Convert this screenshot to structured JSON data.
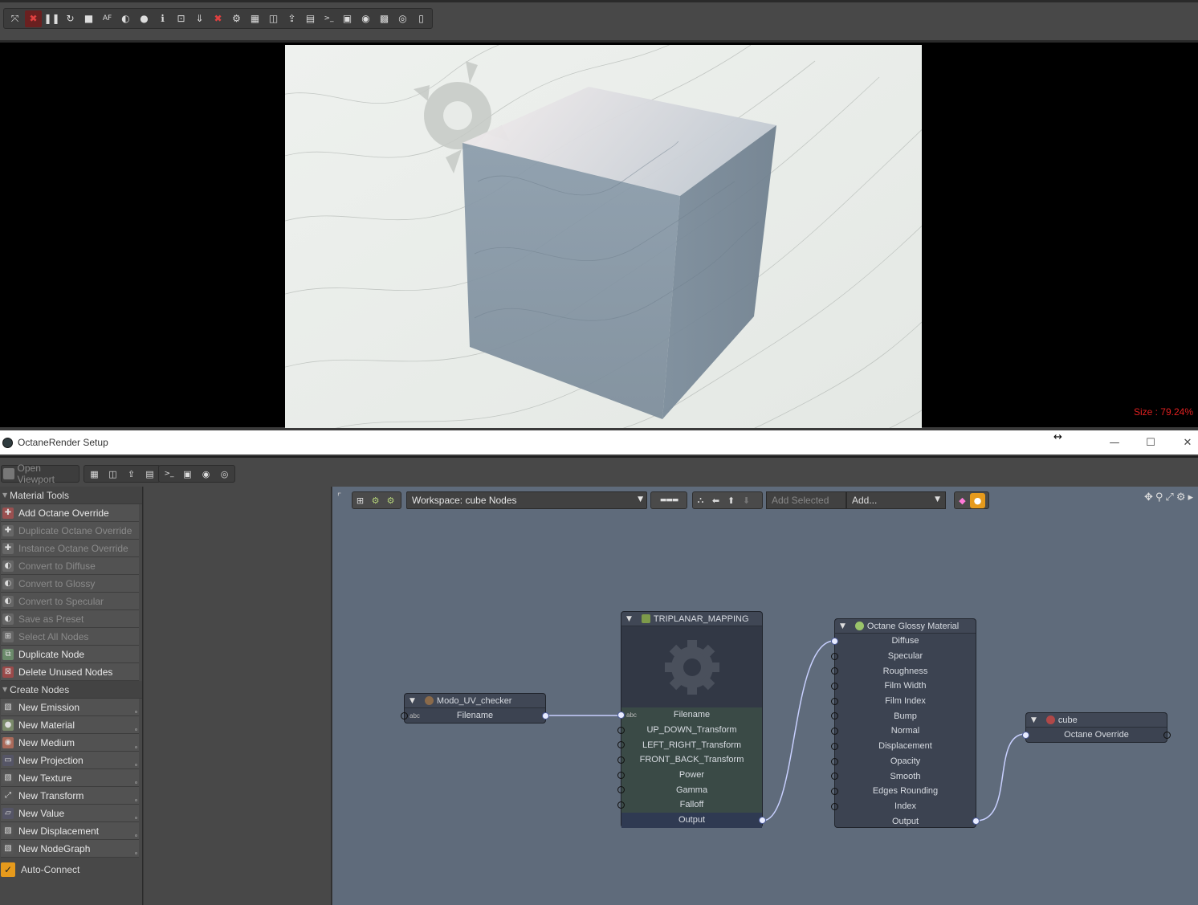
{
  "top_toolbar": {
    "icons": [
      "collapse-icon",
      "stop-render-icon",
      "pause-icon",
      "restart-icon",
      "stop-icon",
      "af-icon",
      "clay-icon",
      "color-icon",
      "info-icon",
      "region-icon",
      "save-icon",
      "cancel-icon",
      "settings-icon",
      "material-icon",
      "camera-icon",
      "export-icon",
      "layers-icon",
      "console-icon",
      "monitor-icon",
      "portrait-icon",
      "checker-icon",
      "livedb-icon",
      "notes-icon"
    ],
    "glyphs": [
      "⤧",
      "✖",
      "❚❚",
      "↻",
      "■",
      "AF",
      "◐",
      "●",
      "ℹ",
      "⊡",
      "⇓",
      "✖",
      "⚙",
      "▦",
      "◫",
      "⇪",
      "▤",
      ">_",
      "▣",
      "◉",
      "▩",
      "◎",
      "▯"
    ]
  },
  "viewport": {
    "size_label": "Size : 79.24%"
  },
  "setup_window": {
    "title": "OctaneRender Setup",
    "resize_glyph": "↔",
    "minimize": "—",
    "maximize": "☐",
    "close": "✕"
  },
  "second_toolbar": {
    "open_viewport": "Open Viewport",
    "group_a": [
      "▦",
      "◫",
      "⇪",
      "▤"
    ],
    "group_b": [
      ">_",
      "▣",
      "◉",
      "◎"
    ]
  },
  "material_tools": {
    "header": "Material Tools",
    "items": [
      {
        "label": "Add Octane Override",
        "enabled": true,
        "icon": "override-add-icon",
        "glyph": "✚",
        "color": "#9a5050"
      },
      {
        "label": "Duplicate Octane Override",
        "enabled": false,
        "icon": "override-duplicate-icon",
        "glyph": "✚",
        "color": "#666"
      },
      {
        "label": "Instance Octane Override",
        "enabled": false,
        "icon": "override-instance-icon",
        "glyph": "✚",
        "color": "#666"
      },
      {
        "label": "Convert to Diffuse",
        "enabled": false,
        "icon": "convert-diffuse-icon",
        "glyph": "◐",
        "color": "#666"
      },
      {
        "label": "Convert to Glossy",
        "enabled": false,
        "icon": "convert-glossy-icon",
        "glyph": "◐",
        "color": "#666"
      },
      {
        "label": "Convert to Specular",
        "enabled": false,
        "icon": "convert-specular-icon",
        "glyph": "◐",
        "color": "#666"
      },
      {
        "label": "Save as Preset",
        "enabled": false,
        "icon": "save-preset-icon",
        "glyph": "◐",
        "color": "#666"
      },
      {
        "label": "Select All Nodes",
        "enabled": false,
        "icon": "select-nodes-icon",
        "glyph": "⊞",
        "color": "#666"
      },
      {
        "label": "Duplicate Node",
        "enabled": true,
        "icon": "duplicate-node-icon",
        "glyph": "⧉",
        "color": "#6a8a6a"
      },
      {
        "label": "Delete Unused Nodes",
        "enabled": true,
        "icon": "delete-nodes-icon",
        "glyph": "⊠",
        "color": "#9a4a4a"
      }
    ]
  },
  "create_nodes": {
    "header": "Create Nodes",
    "items": [
      {
        "label": "New Emission",
        "icon": "emission-icon",
        "glyph": "▧",
        "color": "#555"
      },
      {
        "label": "New Material",
        "icon": "material-icon",
        "glyph": "●",
        "color": "#7a8a6a"
      },
      {
        "label": "New Medium",
        "icon": "medium-icon",
        "glyph": "◉",
        "color": "#aa6a5a"
      },
      {
        "label": "New Projection",
        "icon": "projection-icon",
        "glyph": "▭",
        "color": "#556"
      },
      {
        "label": "New Texture",
        "icon": "texture-icon",
        "glyph": "▧",
        "color": "#555"
      },
      {
        "label": "New Transform",
        "icon": "transform-icon",
        "glyph": "⤢",
        "color": "#555"
      },
      {
        "label": "New Value",
        "icon": "value-icon",
        "glyph": "▱",
        "color": "#556"
      },
      {
        "label": "New Displacement",
        "icon": "displacement-icon",
        "glyph": "▧",
        "color": "#555"
      },
      {
        "label": "New NodeGraph",
        "icon": "nodegraph-icon",
        "glyph": "▧",
        "color": "#555"
      }
    ]
  },
  "auto_connect": {
    "label": "Auto-Connect",
    "checked": true,
    "check_glyph": "✓"
  },
  "node_editor": {
    "corner_glyph": "⌜",
    "workspace_label": "Workspace: cube Nodes",
    "layout_glyph": "▬▬▬",
    "add_selected_placeholder": "Add Selected",
    "add_label": "Add...",
    "dropdown_arrow": "▼",
    "right_controls": [
      "✥",
      "⚲",
      "⤢",
      "⚙",
      "▸"
    ],
    "nodes": {
      "checker": {
        "title": "Modo_UV_checker",
        "params": [
          "Filename"
        ],
        "abc": "abc"
      },
      "triplanar": {
        "title": "TRIPLANAR_MAPPING",
        "params": [
          "Filename",
          "UP_DOWN_Transform",
          "LEFT_RIGHT_Transform",
          "FRONT_BACK_Transform",
          "Power",
          "Gamma",
          "Falloff"
        ],
        "output": "Output",
        "abc": "abc"
      },
      "glossy": {
        "title": "Octane Glossy Material",
        "params": [
          "Diffuse",
          "Specular",
          "Roughness",
          "Film Width",
          "Film Index",
          "Bump",
          "Normal",
          "Displacement",
          "Opacity",
          "Smooth",
          "Edges Rounding",
          "Index"
        ],
        "output": "Output"
      },
      "cube": {
        "title": "cube",
        "params": [
          "Octane Override"
        ]
      }
    }
  }
}
